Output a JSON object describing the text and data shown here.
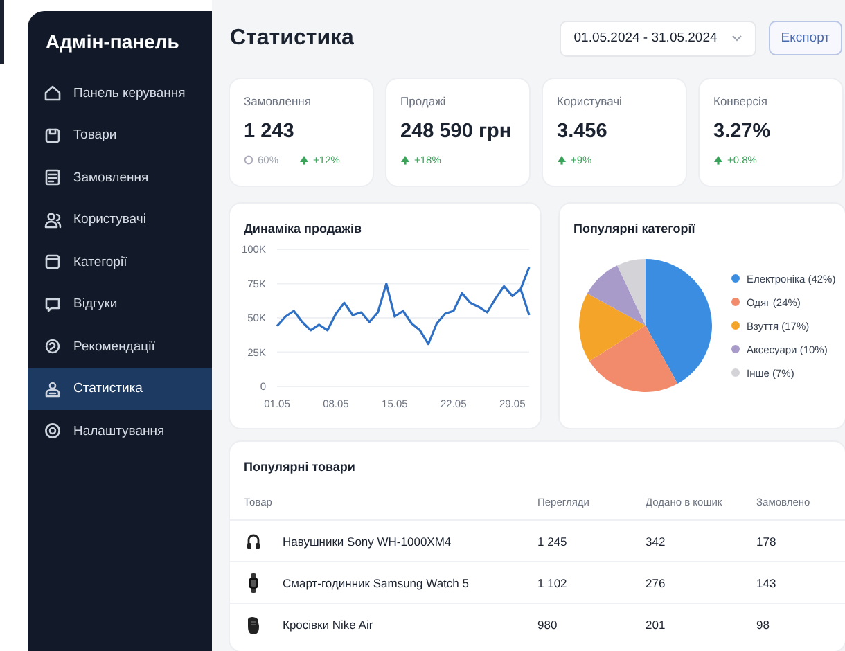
{
  "sidebar": {
    "title": "Адмін-панель",
    "items": [
      {
        "label": "Панель керування",
        "selected": false
      },
      {
        "label": "Товари",
        "selected": false
      },
      {
        "label": "Замовлення",
        "selected": false
      },
      {
        "label": "Користувачі",
        "selected": false
      },
      {
        "label": "Категорії",
        "selected": false
      },
      {
        "label": "Відгуки",
        "selected": false
      },
      {
        "label": "Рекомендації",
        "selected": false
      },
      {
        "label": "Статистика",
        "selected": true
      },
      {
        "label": "Налаштування",
        "selected": false
      }
    ]
  },
  "header": {
    "title": "Статистика",
    "date_range": "01.05.2024 - 31.05.2024",
    "export_button": "Експорт"
  },
  "stats": [
    {
      "label": "Замовлення",
      "value": "1 243",
      "secondary": "60%",
      "change": "+12%"
    },
    {
      "label": "Продажі",
      "value": "248 590 грн",
      "change": "+18%"
    },
    {
      "label": "Користувачі",
      "value": "3.456",
      "change": "+9%"
    },
    {
      "label": "Конверсія",
      "value": "3.27%",
      "change": "+0.8%"
    }
  ],
  "sales_chart": {
    "title": "Динаміка продажів",
    "chart_data": {
      "type": "line",
      "categories": [
        "01.05",
        null,
        null,
        null,
        null,
        null,
        null,
        "08.05",
        null,
        null,
        null,
        null,
        null,
        null,
        "15.05",
        null,
        null,
        null,
        null,
        null,
        null,
        "22.05",
        null,
        null,
        null,
        null,
        null,
        null,
        "29.05",
        null,
        null
      ],
      "series": [
        {
          "color": "#2f6fc4",
          "values": [
            44000,
            51000,
            55000,
            47000,
            41000,
            45000,
            41000,
            53000,
            61000,
            52000,
            54000,
            47000,
            54000,
            75000,
            51000,
            55000,
            46000,
            41000,
            31000,
            46000,
            53000,
            55000,
            68000,
            61000,
            58000,
            54000,
            64000,
            73000,
            66000,
            71000,
            87000
          ]
        },
        {
          "color": "#2f6fc4",
          "values": [
            null,
            null,
            null,
            null,
            null,
            null,
            null,
            null,
            null,
            null,
            null,
            null,
            null,
            null,
            null,
            null,
            null,
            null,
            null,
            null,
            null,
            null,
            null,
            null,
            null,
            null,
            null,
            null,
            null,
            71000,
            52000
          ]
        }
      ],
      "ylim": [
        0,
        100000
      ],
      "grid": true,
      "yticks": [
        {
          "value": 0,
          "label": "0"
        },
        {
          "value": 25000,
          "label": "25K"
        },
        {
          "value": 50000,
          "label": "50K"
        },
        {
          "value": 75000,
          "label": "75K"
        },
        {
          "value": 100000,
          "label": "100K"
        }
      ]
    }
  },
  "categories_chart": {
    "title": "Популярні категорії",
    "chart_data": {
      "type": "pie",
      "series": [
        {
          "values": [
            42,
            24,
            17,
            10,
            7
          ]
        }
      ]
    },
    "legend": [
      {
        "label": "Електроніка (42%)",
        "color": "#3a8de0"
      },
      {
        "label": "Одяг (24%)",
        "color": "#f28a6c"
      },
      {
        "label": "Взуття (17%)",
        "color": "#f5a42a"
      },
      {
        "label": "Аксесуари (10%)",
        "color": "#a89bca"
      },
      {
        "label": "Інше (7%)",
        "color": "#d4d4d8"
      }
    ]
  },
  "products": {
    "title": "Популярні товари",
    "columns": [
      "Товар",
      "Перегляди",
      "Додано в кошик",
      "Замовлено"
    ],
    "rows": [
      {
        "cells": [
          "Навушники Sony WH-1000XM4",
          "1 245",
          "342",
          "178"
        ]
      },
      {
        "cells": [
          "Смарт-годинник Samsung Watch 5",
          "1 102",
          "276",
          "143"
        ]
      },
      {
        "cells": [
          "Кросівки Nike Air",
          "980",
          "201",
          "98"
        ]
      }
    ]
  }
}
